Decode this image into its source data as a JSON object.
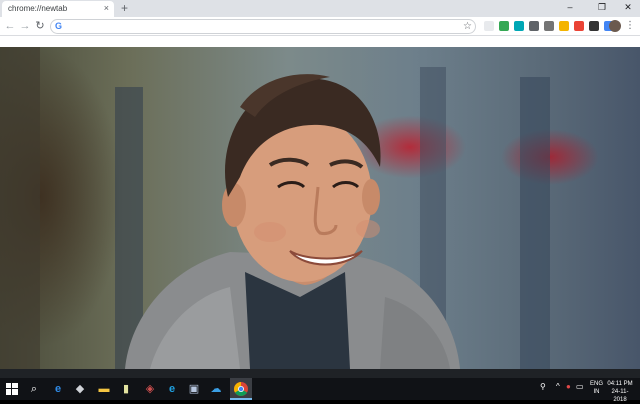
{
  "browser": {
    "tab_title": "chrome://newtab",
    "tab_close": "×",
    "new_tab": "+",
    "minimize": "–",
    "maximize": "❐",
    "close": "✕"
  },
  "toolbar": {
    "back": "←",
    "forward": "→",
    "reload": "↻",
    "address_value": "",
    "google_glyph": "G",
    "star": "☆",
    "menu": "⋮"
  },
  "extensions": [
    {
      "name": "extension-1",
      "color": "#e8eaed"
    },
    {
      "name": "extension-2",
      "color": "#34a853"
    },
    {
      "name": "extension-3",
      "color": "#00a7b5"
    },
    {
      "name": "extension-4",
      "color": "#5f6368"
    },
    {
      "name": "extension-5",
      "color": "#757575"
    },
    {
      "name": "extension-6",
      "color": "#f4b400"
    },
    {
      "name": "extension-7",
      "color": "#ea4335"
    },
    {
      "name": "extension-8",
      "color": "#333333"
    },
    {
      "name": "extension-9",
      "color": "#4285f4"
    }
  ],
  "content": {
    "background_image": "photo-of-smiling-man-in-gray-hoodie"
  },
  "taskbar": {
    "start_icon": "windows-logo",
    "search_icon": "⌕",
    "apps": [
      "edge",
      "app-2",
      "file-explorer",
      "app-4",
      "app-5",
      "internet-explorer",
      "app-7",
      "app-8",
      "chrome"
    ],
    "tray_caret": "^",
    "lang_line1": "ENG",
    "lang_line2": "IN",
    "time": "04:11 PM",
    "date": "24-11-2018"
  },
  "colors": {
    "tabstrip": "#dee1e6",
    "taskbar": "#101216",
    "taskbar_accent": "#76b9ed"
  }
}
